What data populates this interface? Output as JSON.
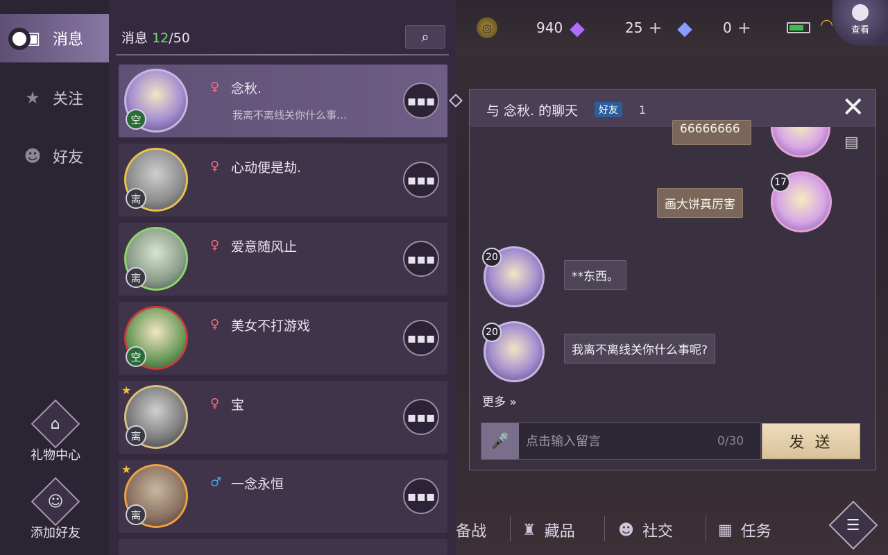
{
  "topbar": {
    "coin": "940",
    "gem_purple": "25",
    "gem_blue": "0",
    "view_label": "查看"
  },
  "nav": {
    "items": [
      {
        "label": "消息"
      },
      {
        "label": "关注"
      },
      {
        "label": "好友"
      }
    ],
    "gift_center": "礼物中心",
    "add_friend": "添加好友"
  },
  "list": {
    "title": "消息",
    "count": "12",
    "total": "/50",
    "rows": [
      {
        "name": "念秋.",
        "preview": "我离不离线关你什么事…",
        "status": "空",
        "gender": "♀"
      },
      {
        "name": "心动便是劫.",
        "preview": "",
        "status": "离",
        "gender": "♀"
      },
      {
        "name": "爱意随风止",
        "preview": "",
        "status": "离",
        "gender": "♀"
      },
      {
        "name": "美女不打游戏",
        "preview": "",
        "status": "空",
        "gender": "♀"
      },
      {
        "name": "宝",
        "preview": "",
        "status": "离",
        "gender": "♀"
      },
      {
        "name": "一念永恒",
        "preview": "",
        "status": "离",
        "gender": "♂"
      }
    ]
  },
  "chat": {
    "title": "与 念秋. 的聊天",
    "badge": "好友",
    "friend_level": "1",
    "messages": [
      {
        "text": "66666666",
        "from": "me"
      },
      {
        "text": "画大饼真厉害",
        "from": "me",
        "level": "17"
      },
      {
        "text": "**东西。",
        "from": "them",
        "level": "20"
      },
      {
        "text": "我离不离线关你什么事呢?",
        "from": "them",
        "level": "20"
      }
    ],
    "more": "更多 »",
    "input_placeholder": "点击输入留言",
    "counter": "0/30",
    "send": "发 送"
  },
  "bottomnav": {
    "items": [
      "备战",
      "藏品",
      "社交",
      "任务"
    ]
  }
}
